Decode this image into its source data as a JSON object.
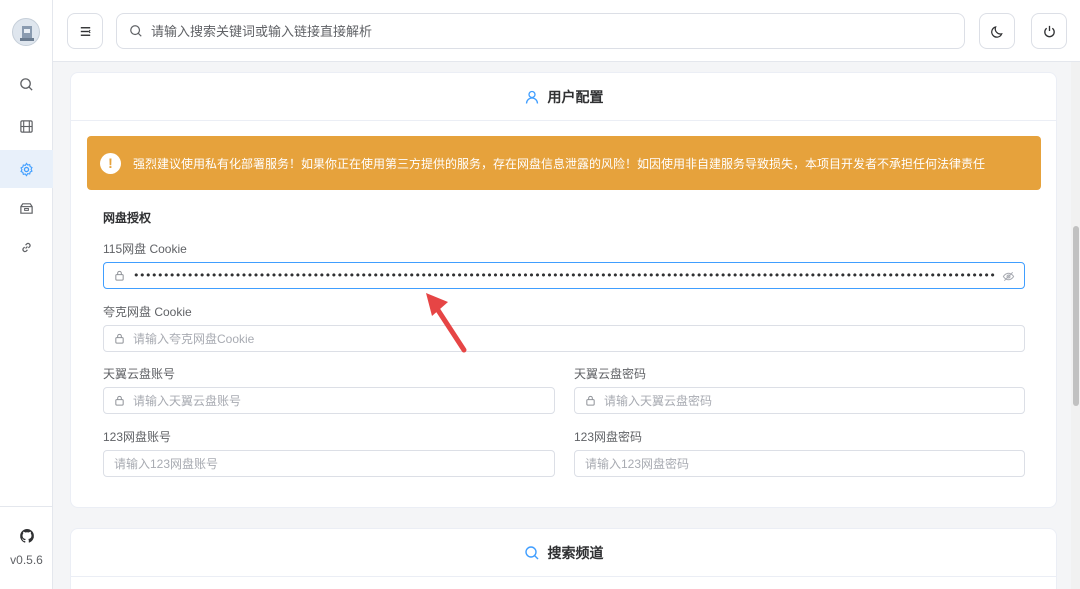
{
  "sidebar": {
    "items": [
      {
        "name": "search",
        "icon": "search-icon"
      },
      {
        "name": "movies",
        "icon": "film-icon"
      },
      {
        "name": "settings",
        "icon": "gear-icon",
        "active": true
      },
      {
        "name": "box",
        "icon": "box-icon"
      },
      {
        "name": "links",
        "icon": "link-icon"
      }
    ],
    "version": "v0.5.6",
    "github_icon": "github-icon"
  },
  "header": {
    "menu_icon": "menu-icon",
    "search_placeholder": "请输入搜索关键词或输入链接直接解析",
    "theme_icon": "moon-icon",
    "power_icon": "power-icon"
  },
  "user_config": {
    "title": "用户配置",
    "alert": "强烈建议使用私有化部署服务！如果你正在使用第三方提供的服务，存在网盘信息泄露的风险！如因使用非自建服务导致损失，本项目开发者不承担任何法律责任",
    "section_title": "网盘授权",
    "fields": {
      "cookie_115": {
        "label": "115网盘 Cookie",
        "value": "••••••••••••••••••••••••••••••••••••••••••••••••••••••••••••••••••••••••••••••••••••••••••••••••••••••••••••••••••••••••••••••••••••••••••••••••••••••••••••••••••••••••••••••••••••••••"
      },
      "quark_cookie": {
        "label": "夸克网盘 Cookie",
        "placeholder": "请输入夸克网盘Cookie"
      },
      "tianyi_account": {
        "label": "天翼云盘账号",
        "placeholder": "请输入天翼云盘账号"
      },
      "tianyi_password": {
        "label": "天翼云盘密码",
        "placeholder": "请输入天翼云盘密码"
      },
      "pan123_account": {
        "label": "123网盘账号",
        "placeholder": "请输入123网盘账号"
      },
      "pan123_password": {
        "label": "123网盘密码",
        "placeholder": "请输入123网盘密码"
      }
    }
  },
  "search_channels": {
    "title": "搜索频道"
  },
  "colors": {
    "accent": "#409eff",
    "warning": "#e6a23c",
    "arrow": "#e64545"
  }
}
